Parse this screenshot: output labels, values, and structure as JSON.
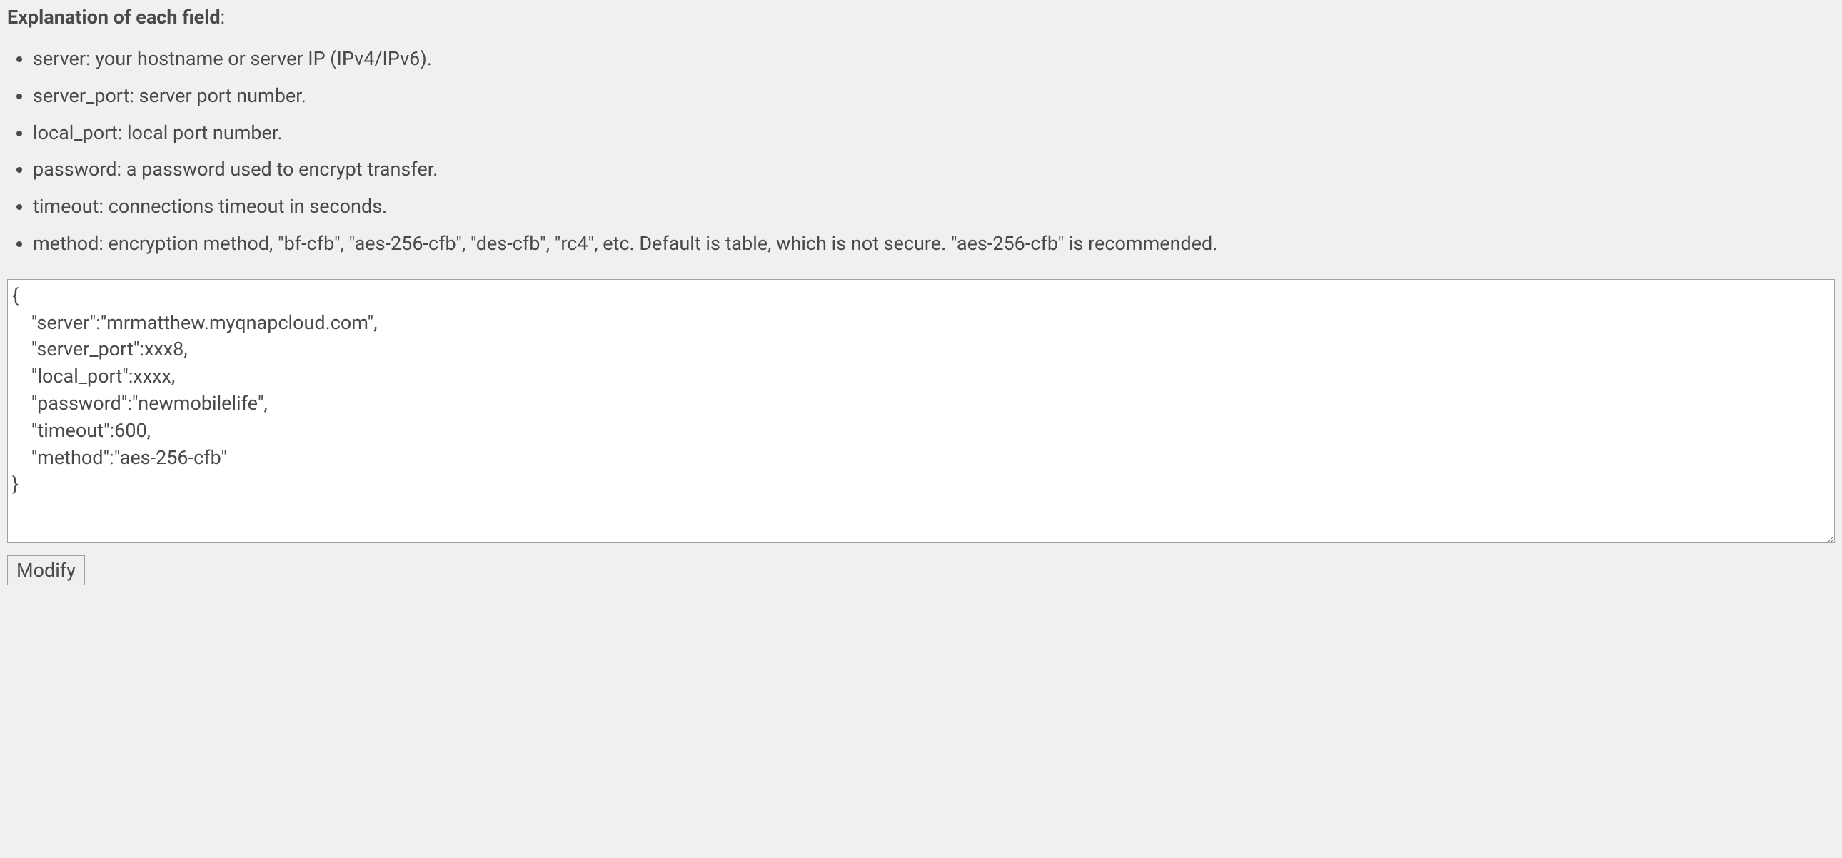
{
  "header": {
    "title_bold": "Explanation of each field",
    "title_suffix": ":"
  },
  "fields": [
    "server: your hostname or server IP (IPv4/IPv6).",
    "server_port: server port number.",
    "local_port: local port number.",
    "password: a password used to encrypt transfer.",
    "timeout: connections timeout in seconds.",
    "method: encryption method, \"bf-cfb\", \"aes-256-cfb\", \"des-cfb\", \"rc4\", etc. Default is table, which is not secure. \"aes-256-cfb\" is recommended."
  ],
  "textarea": {
    "value": "{\n    \"server\":\"mrmatthew.myqnapcloud.com\",\n    \"server_port\":xxx8,\n    \"local_port\":xxxx,\n    \"password\":\"newmobilelife\",\n    \"timeout\":600,\n    \"method\":\"aes-256-cfb\"\n}"
  },
  "button": {
    "modify_label": "Modify"
  }
}
